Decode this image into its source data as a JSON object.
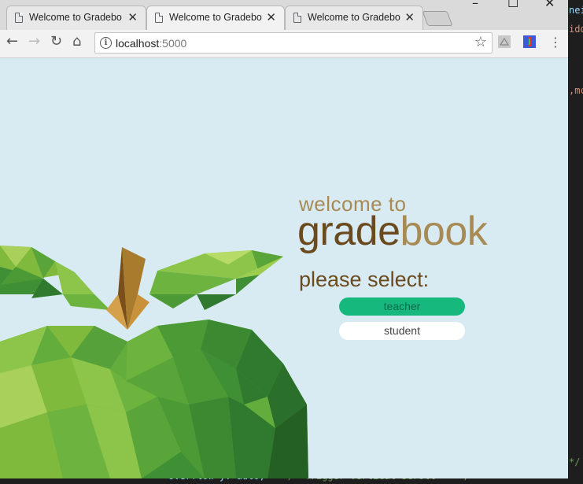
{
  "tabs": [
    {
      "title": "Welcome to Gradebook",
      "active": false
    },
    {
      "title": "Welcome to Gradebook",
      "active": true
    },
    {
      "title": "Welcome to Gradebook",
      "active": false
    }
  ],
  "window_controls": {
    "minimize": "–",
    "maximize": "☐",
    "close": "✕"
  },
  "toolbar": {
    "back": "←",
    "forward": "→",
    "reload": "↻",
    "home": "⌂",
    "url_host": "localhost",
    "url_port": ":5000",
    "bookmark": "☆",
    "menu": "⋮"
  },
  "page": {
    "welcome": "welcome to",
    "brand_part1": "grade",
    "brand_part2": "book",
    "prompt": "please select:",
    "buttons": {
      "teacher": "teacher",
      "student": "student"
    }
  },
  "colors": {
    "page_bg": "#d8ebf2",
    "brand_dark": "#6b4a1f",
    "brand_light": "#a88a55",
    "teacher_btn": "#16b87e",
    "student_btn": "#ffffff"
  },
  "icons": [
    "page-icon",
    "close-icon",
    "info-icon",
    "star-icon",
    "pdf-extension-icon",
    "extension-icon",
    "menu-icon",
    "apple-illustration"
  ],
  "editor_fragments": {
    "right": [
      "nei",
      "idd",
      ",mc",
      "*/",
      "*/"
    ],
    "bottom_code": "overflow-y: auto;",
    "bottom_comment": "/* Trigger vertical scroll    */"
  }
}
